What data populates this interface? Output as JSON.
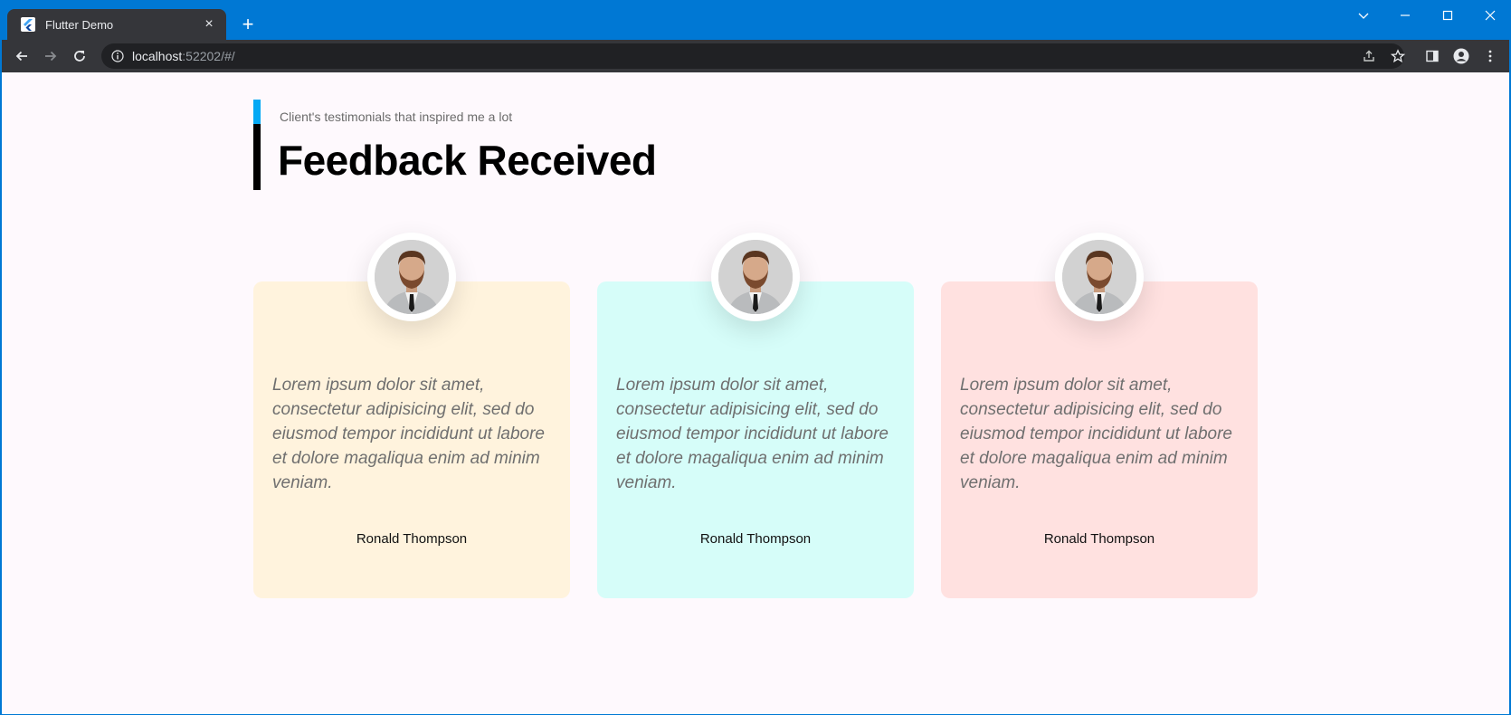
{
  "browser": {
    "tab_title": "Flutter Demo",
    "url_host": "localhost",
    "url_rest": ":52202/#/"
  },
  "page": {
    "subtitle": "Client's testimonials that inspired me a lot",
    "title": "Feedback Received",
    "accent_color": "#03a9f4"
  },
  "testimonials": [
    {
      "text": "Lorem ipsum dolor sit amet, consectetur adipisicing elit, sed do eiusmod tempor incididunt ut labore et dolore magaliqua enim ad minim veniam.",
      "name": "Ronald Thompson",
      "color": "#fff3dd"
    },
    {
      "text": "Lorem ipsum dolor sit amet, consectetur adipisicing elit, sed do eiusmod tempor incididunt ut labore et dolore magaliqua enim ad minim veniam.",
      "name": "Ronald Thompson",
      "color": "#d6fdf9"
    },
    {
      "text": "Lorem ipsum dolor sit amet, consectetur adipisicing elit, sed do eiusmod tempor incididunt ut labore et dolore magaliqua enim ad minim veniam.",
      "name": "Ronald Thompson",
      "color": "#ffe1e0"
    }
  ]
}
